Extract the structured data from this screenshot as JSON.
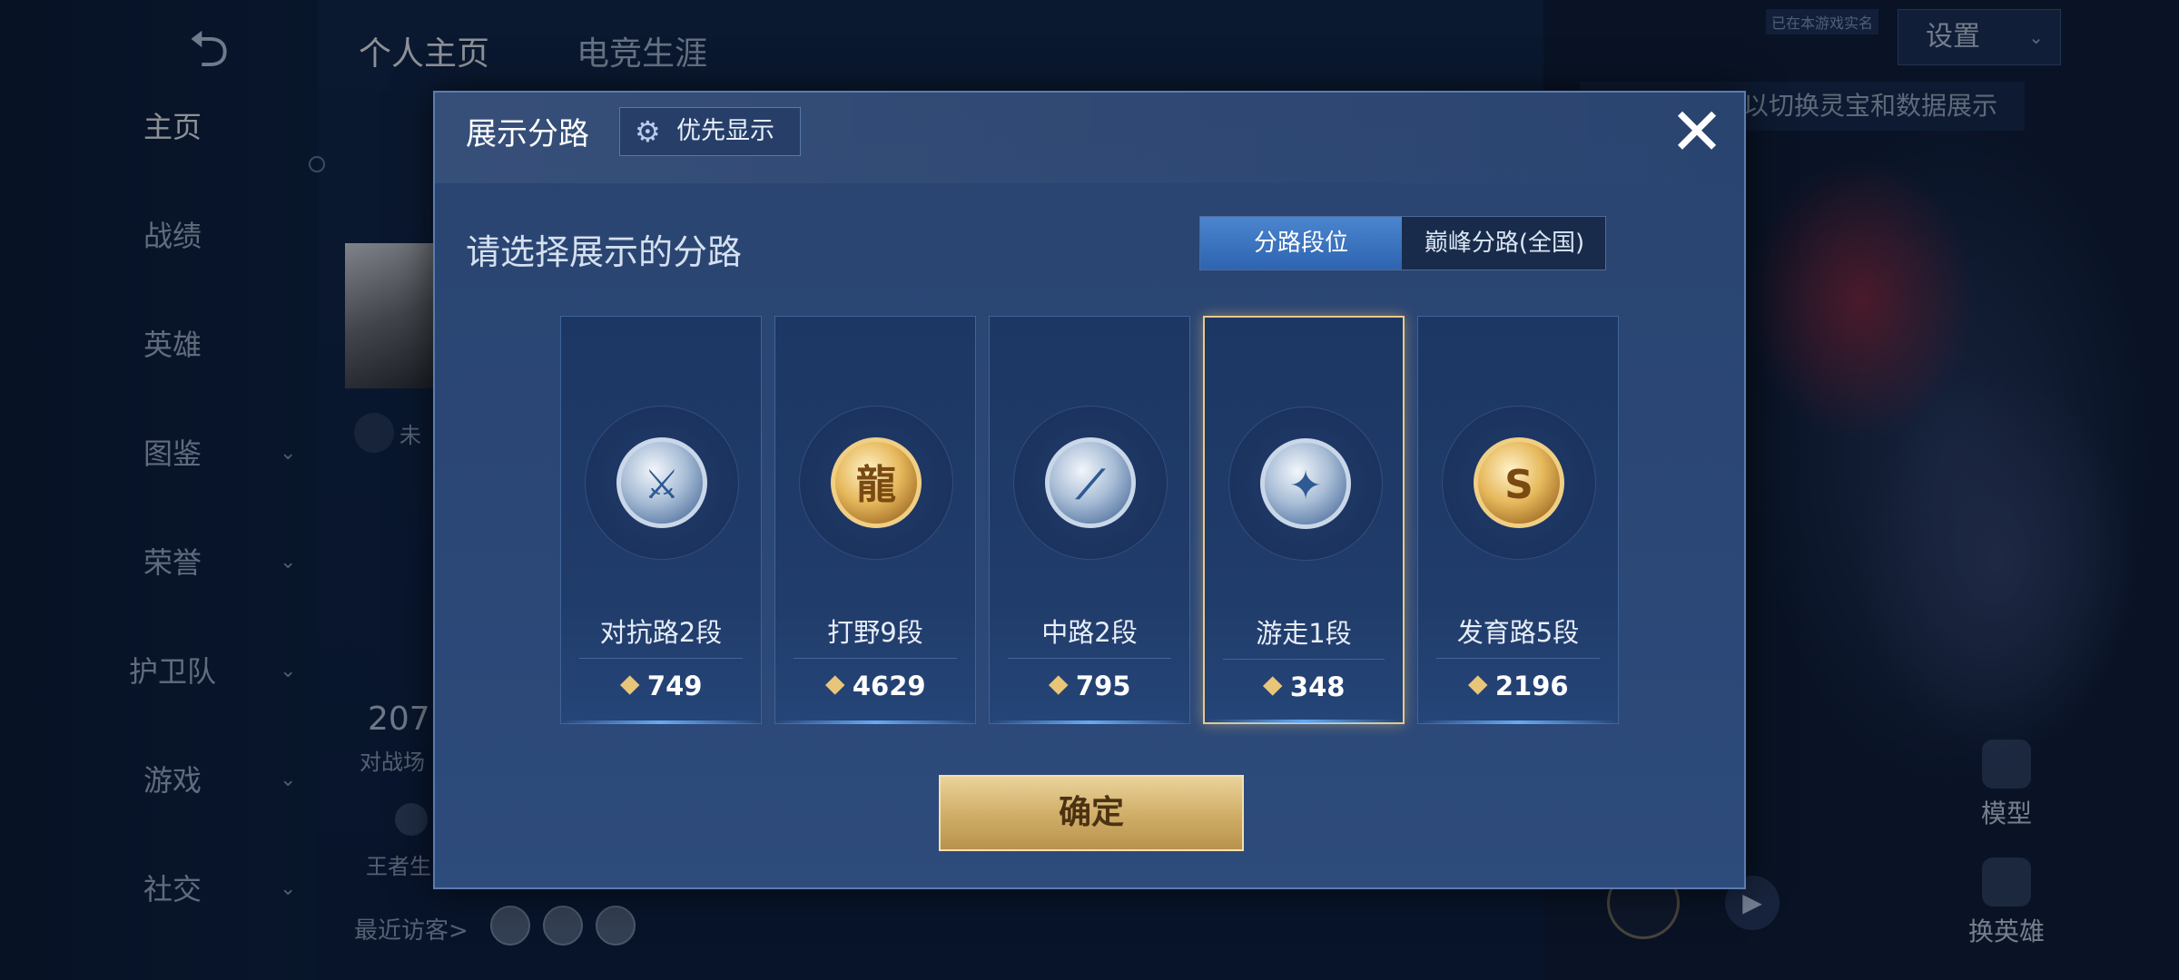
{
  "background": {
    "back_icon": "back-arrow-icon",
    "tabs": [
      "个人主页",
      "电竞生涯"
    ],
    "sidebar": [
      {
        "label": "主页",
        "has_chevron": false
      },
      {
        "label": "战绩",
        "has_chevron": false
      },
      {
        "label": "英雄",
        "has_chevron": false
      },
      {
        "label": "图鉴",
        "has_chevron": true
      },
      {
        "label": "荣誉",
        "has_chevron": true
      },
      {
        "label": "护卫队",
        "has_chevron": true
      },
      {
        "label": "游戏",
        "has_chevron": true
      },
      {
        "label": "社交",
        "has_chevron": true
      }
    ],
    "chevron_glyph": "⌄",
    "settings_label": "设置",
    "top_tag": "已在本游戏实名",
    "hint_text": "以切换灵宝和数据展示",
    "profile_status": "未",
    "stat_number": "207",
    "stat_label": "对战场",
    "king_label": "王者生",
    "visitors_label": "最近访客>",
    "model_label": "模型",
    "change_hero_label": "换英雄"
  },
  "modal": {
    "title": "展示分路",
    "priority_button": "优先显示",
    "close_glyph": "✕",
    "subtitle": "请选择展示的分路",
    "segments": [
      "分路段位",
      "巅峰分路(全国)"
    ],
    "active_segment": 0,
    "lanes": [
      {
        "name": "对抗路2段",
        "score": "749",
        "badge": "silver",
        "glyph": "⚔"
      },
      {
        "name": "打野9段",
        "score": "4629",
        "badge": "gold",
        "glyph": "龍"
      },
      {
        "name": "中路2段",
        "score": "795",
        "badge": "silver",
        "glyph": "⟋"
      },
      {
        "name": "游走1段",
        "score": "348",
        "badge": "silver",
        "glyph": "✦"
      },
      {
        "name": "发育路5段",
        "score": "2196",
        "badge": "gold",
        "glyph": "S"
      }
    ],
    "selected_lane": 3,
    "points_glyph": "⯁",
    "confirm_button": "确定"
  },
  "colors": {
    "gold_accent": "#e8c98a",
    "segment_active": "#3a72bf",
    "confirm_gold": "#d2b06a"
  }
}
